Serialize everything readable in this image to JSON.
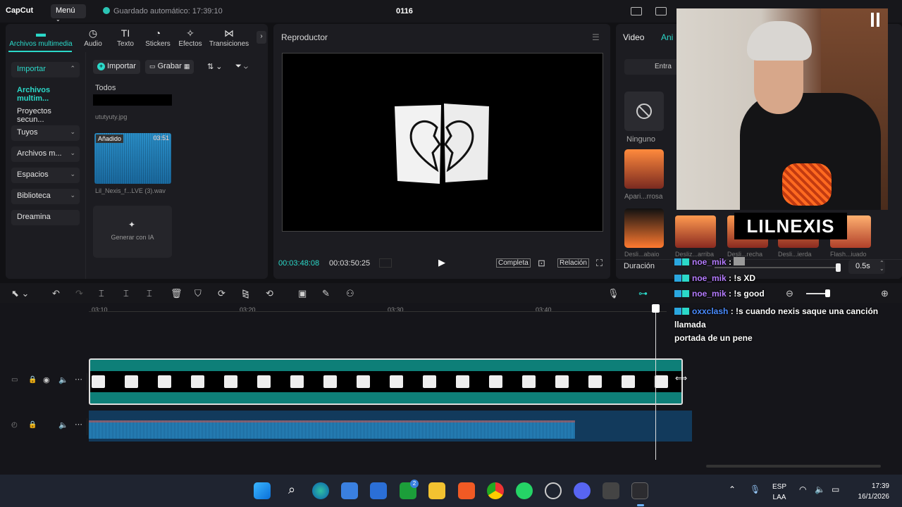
{
  "app": {
    "logo": "CapCut",
    "menu_label": "Menú",
    "autosave_text": "Guardado automático: 17:39:10",
    "project_title": "0116"
  },
  "left_tabs": [
    {
      "label": "Archivos multimedia",
      "icon": "media-icon"
    },
    {
      "label": "Audio",
      "icon": "audio-icon"
    },
    {
      "label": "Texto",
      "icon": "text-icon"
    },
    {
      "label": "Stickers",
      "icon": "sticker-icon"
    },
    {
      "label": "Efectos",
      "icon": "effects-icon"
    },
    {
      "label": "Transiciones",
      "icon": "transitions-icon"
    }
  ],
  "sidebar": {
    "items": [
      {
        "label": "Importar"
      },
      {
        "label": "Archivos multim..."
      },
      {
        "label": "Proyectos secun..."
      },
      {
        "label": "Tuyos"
      },
      {
        "label": "Archivos m..."
      },
      {
        "label": "Espacios"
      },
      {
        "label": "Biblioteca"
      },
      {
        "label": "Dreamina"
      }
    ]
  },
  "media": {
    "import_label": "Importar",
    "record_label": "Grabar",
    "section_label": "Todos",
    "items": [
      {
        "filename": "ututyuty.jpg"
      },
      {
        "filename": "Lil_Nexis_f...LVE (3).wav",
        "added_badge": "Añadido",
        "duration": "03:51"
      }
    ],
    "ai_label": "Generar con IA"
  },
  "player": {
    "title": "Reproductor",
    "current_time": "00:03:48:08",
    "total_time": "00:03:50:25",
    "full_label": "Completa",
    "ratio_label": "Relación"
  },
  "right_panel": {
    "tab_video": "Video",
    "tab_anim": "Ani",
    "sub_tab": "Entra",
    "none_label": "Ninguno",
    "items": [
      {
        "label": "Apari...rrosa"
      },
      {
        "label": "Desli...abajo"
      },
      {
        "label": "Desliz...arriba"
      },
      {
        "label": "Desli...recha"
      },
      {
        "label": "Desli...ierda"
      },
      {
        "label": "Flash...iuado"
      }
    ],
    "duration_label": "Duración",
    "duration_value": "0.5s"
  },
  "overlay": {
    "streamer_name": "LILNEXIS"
  },
  "chat": [
    {
      "user": "noe_mik",
      "message": ""
    },
    {
      "user": "noe_mik",
      "message": "!s XD"
    },
    {
      "user": "noe_mik",
      "message": "!s good"
    },
    {
      "user": "oxxclash",
      "message": "!s cuando nexis saque una canción llamada",
      "message2": "portada de un pene"
    }
  ],
  "timeline": {
    "ruler_ticks": [
      "03:10",
      "03:20",
      "03:30",
      "03:40"
    ]
  },
  "taskbar": {
    "lang": "ESP",
    "layout": "LAA",
    "time": "17:39",
    "date": "16/1/2026",
    "notif_badge": "2"
  }
}
